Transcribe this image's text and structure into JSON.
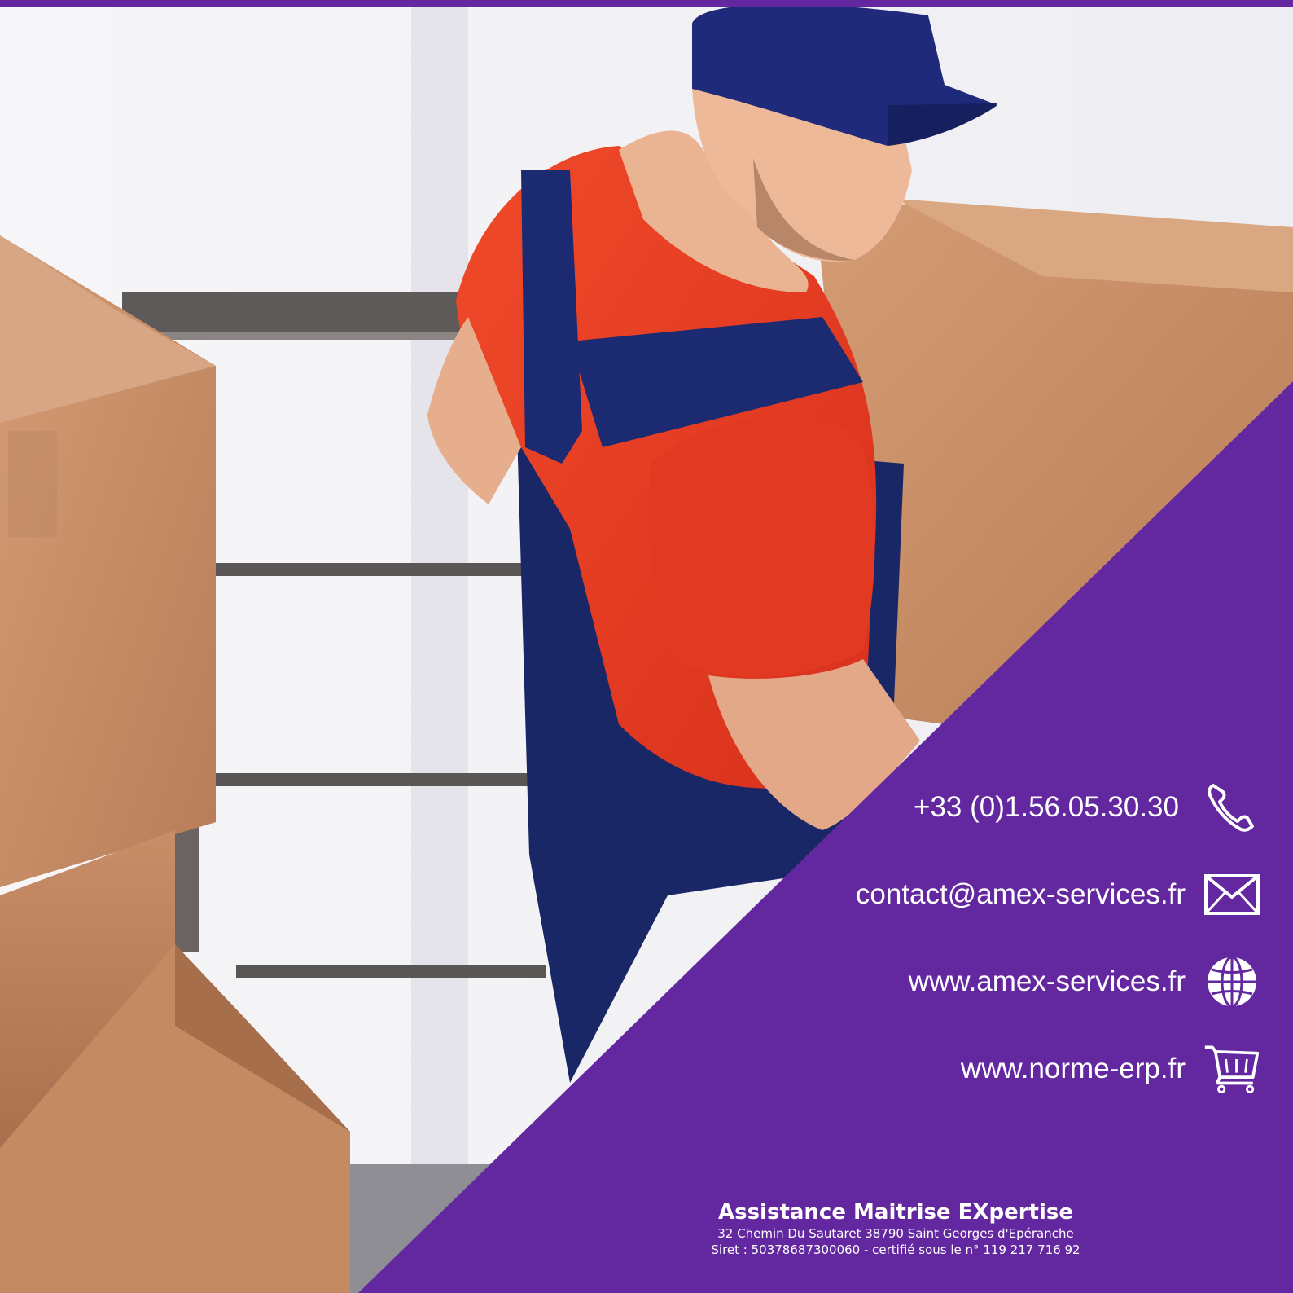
{
  "colors": {
    "accent": "#6328a0",
    "shirt": "#ee3a22",
    "overall": "#1a2766",
    "cap": "#1f2a7a",
    "box": "#c98f66",
    "skin": "#e8b08e"
  },
  "contacts": [
    {
      "icon": "phone-icon",
      "text": "+33 (0)1.56.05.30.30"
    },
    {
      "icon": "envelope-icon",
      "text": "contact@amex-services.fr"
    },
    {
      "icon": "globe-icon",
      "text": "www.amex-services.fr"
    },
    {
      "icon": "shopping-cart-icon",
      "text": "www.norme-erp.fr"
    }
  ],
  "footer": {
    "company": "Assistance Maitrise EXpertise",
    "address": "32 Chemin Du Sautaret 38790 Saint Georges d'Epéranche",
    "siret": "Siret : 50378687300060 - certifié sous le n° 119 217 716 92"
  }
}
